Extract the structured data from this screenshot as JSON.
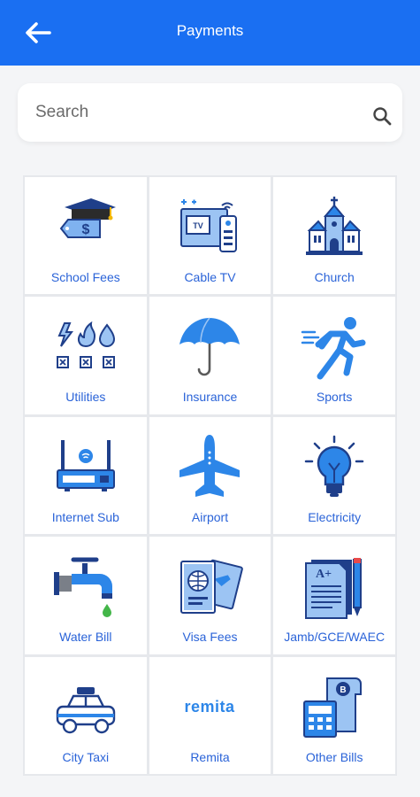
{
  "header": {
    "title": "Payments"
  },
  "search": {
    "placeholder": "Search",
    "value": ""
  },
  "categories": [
    {
      "label": "School Fees",
      "icon": "school-fees-icon"
    },
    {
      "label": "Cable TV",
      "icon": "cable-tv-icon"
    },
    {
      "label": "Church",
      "icon": "church-icon"
    },
    {
      "label": "Utilities",
      "icon": "utilities-icon"
    },
    {
      "label": "Insurance",
      "icon": "umbrella-icon"
    },
    {
      "label": "Sports",
      "icon": "runner-icon"
    },
    {
      "label": "Internet Sub",
      "icon": "router-icon"
    },
    {
      "label": "Airport",
      "icon": "airplane-icon"
    },
    {
      "label": "Electricity",
      "icon": "lightbulb-icon"
    },
    {
      "label": "Water Bill",
      "icon": "water-tap-icon"
    },
    {
      "label": "Visa Fees",
      "icon": "passport-icon"
    },
    {
      "label": "Jamb/GCE/WAEC",
      "icon": "exam-paper-icon"
    },
    {
      "label": "City Taxi",
      "icon": "taxi-icon"
    },
    {
      "label": "Remita",
      "icon": "remita-logo"
    },
    {
      "label": "Other Bills",
      "icon": "bills-calculator-icon"
    }
  ],
  "remita_logo_text": "remita",
  "colors": {
    "primary": "#1a6ff2",
    "label": "#2a63d8",
    "icon_blue": "#2d86e8",
    "icon_dark": "#1f3f8a"
  }
}
